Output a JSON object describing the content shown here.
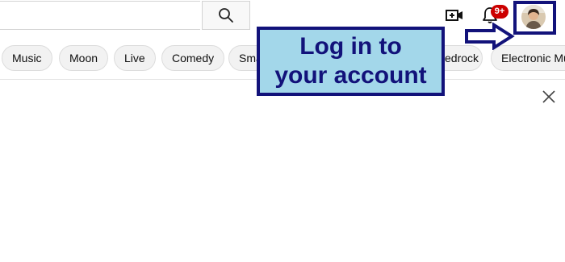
{
  "topbar": {
    "search": {
      "value": "",
      "placeholder": ""
    },
    "notifications": {
      "badge": "9+"
    }
  },
  "chips": [
    {
      "label": "Music"
    },
    {
      "label": "Moon"
    },
    {
      "label": "Live"
    },
    {
      "label": "Comedy"
    },
    {
      "label": "Sma"
    },
    {
      "label": "edrock"
    },
    {
      "label": "Electronic Mu"
    }
  ],
  "callout": {
    "text": "Log in to\nyour account"
  },
  "colors": {
    "callout_fill": "#a3d7ea",
    "callout_border": "#12127a",
    "badge": "#cc0000"
  },
  "icons": [
    "search-icon",
    "create-video-icon",
    "bell-icon",
    "close-icon",
    "arrow-right-icon"
  ]
}
